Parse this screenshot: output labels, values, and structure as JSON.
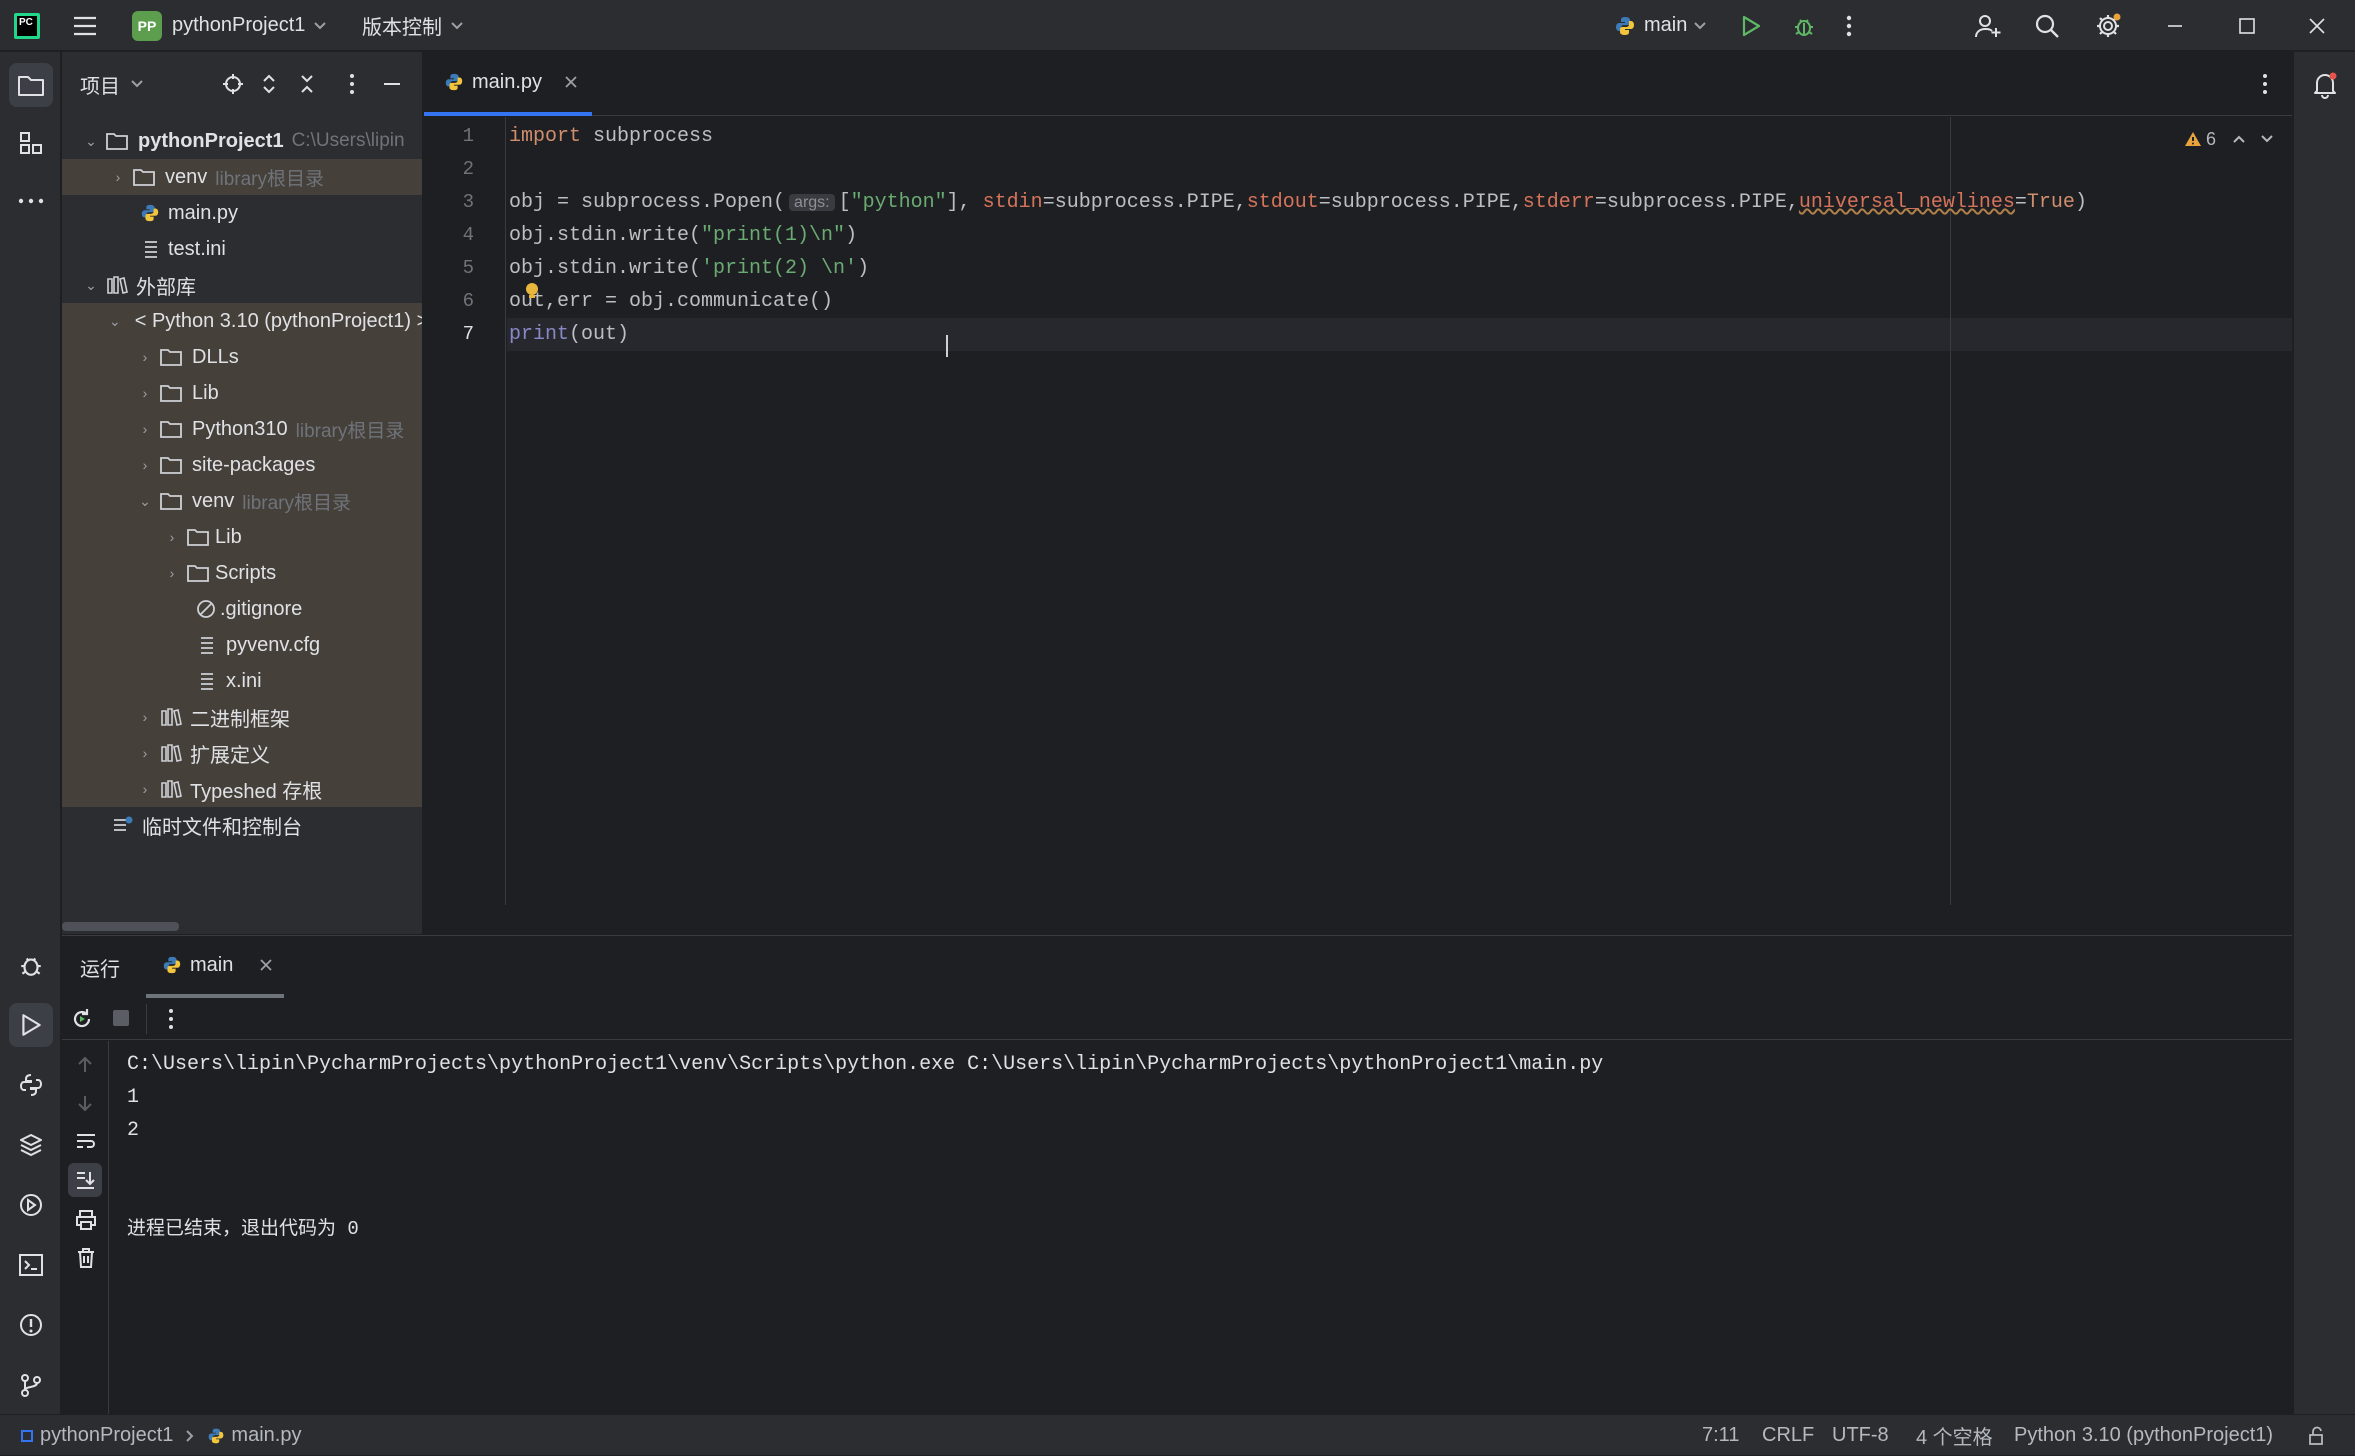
{
  "titlebar": {
    "logo": "PC",
    "project_badge": "PP",
    "project_name": "pythonProject1",
    "vcs_label": "版本控制",
    "run_config": "main"
  },
  "project_panel": {
    "title": "项目",
    "tree": [
      {
        "label": "pythonProject1",
        "extra": "C:\\Users\\lipin"
      },
      {
        "label": "venv",
        "extra": "library根目录"
      },
      {
        "label": "main.py",
        "extra": ""
      },
      {
        "label": "test.ini",
        "extra": ""
      },
      {
        "label": "外部库",
        "extra": ""
      },
      {
        "label": "< Python 3.10 (pythonProject1) >",
        "extra": ""
      },
      {
        "label": "DLLs",
        "extra": ""
      },
      {
        "label": "Lib",
        "extra": ""
      },
      {
        "label": "Python310",
        "extra": "library根目录"
      },
      {
        "label": "site-packages",
        "extra": ""
      },
      {
        "label": "venv",
        "extra": "library根目录"
      },
      {
        "label": "Lib",
        "extra": ""
      },
      {
        "label": "Scripts",
        "extra": ""
      },
      {
        "label": ".gitignore",
        "extra": ""
      },
      {
        "label": "pyvenv.cfg",
        "extra": ""
      },
      {
        "label": "x.ini",
        "extra": ""
      },
      {
        "label": "二进制框架",
        "extra": ""
      },
      {
        "label": "扩展定义",
        "extra": ""
      },
      {
        "label": "Typeshed 存根",
        "extra": ""
      },
      {
        "label": "临时文件和控制台",
        "extra": ""
      }
    ]
  },
  "editor": {
    "tab_label": "main.py",
    "warnings_count": "6",
    "line_numbers": [
      "1",
      "2",
      "3",
      "4",
      "5",
      "6",
      "7"
    ],
    "code": {
      "l1_kw": "import",
      "l1_rest": " subprocess",
      "l3_a": "obj = subprocess.Popen(",
      "l3_hint": "args:",
      "l3_b": "[",
      "l3_str": "\"python\"",
      "l3_c": "], ",
      "l3_p1": "stdin",
      "l3_d": "=subprocess.PIPE,",
      "l3_p2": "stdout",
      "l3_e": "=subprocess.PIPE,",
      "l3_p3": "stderr",
      "l3_f": "=subprocess.PIPE,",
      "l3_p4": "universal_newlines",
      "l3_g": "=",
      "l3_true": "True",
      "l3_h": ")",
      "l4_a": "obj.stdin.write(",
      "l4_str": "\"print(1)\\n\"",
      "l4_b": ")",
      "l5_a": "obj.stdin.write(",
      "l5_str": "'print(2) \\n'",
      "l5_b": ")",
      "l6": "out,err = obj.communicate()",
      "l7_fn": "print",
      "l7_rest": "(out)"
    }
  },
  "run_panel": {
    "title": "运行",
    "tab_label": "main",
    "output": [
      "C:\\Users\\lipin\\PycharmProjects\\pythonProject1\\venv\\Scripts\\python.exe C:\\Users\\lipin\\PycharmProjects\\pythonProject1\\main.py",
      "1",
      "2",
      "",
      "",
      "进程已结束，退出代码为 0"
    ]
  },
  "statusbar": {
    "breadcrumb_project": "pythonProject1",
    "breadcrumb_file": "main.py",
    "position": "7:11",
    "line_sep": "CRLF",
    "encoding": "UTF-8",
    "indent": "4 个空格",
    "interpreter": "Python 3.10 (pythonProject1)"
  },
  "colors": {
    "keyword": "#cf8e6d",
    "string": "#6aab73",
    "named_param": "#d5735b",
    "builtin_fn": "#56a8f5",
    "tree_highlight": "#45403a",
    "run_green": "#5fb865",
    "project_badge": "#5c9e4e"
  }
}
